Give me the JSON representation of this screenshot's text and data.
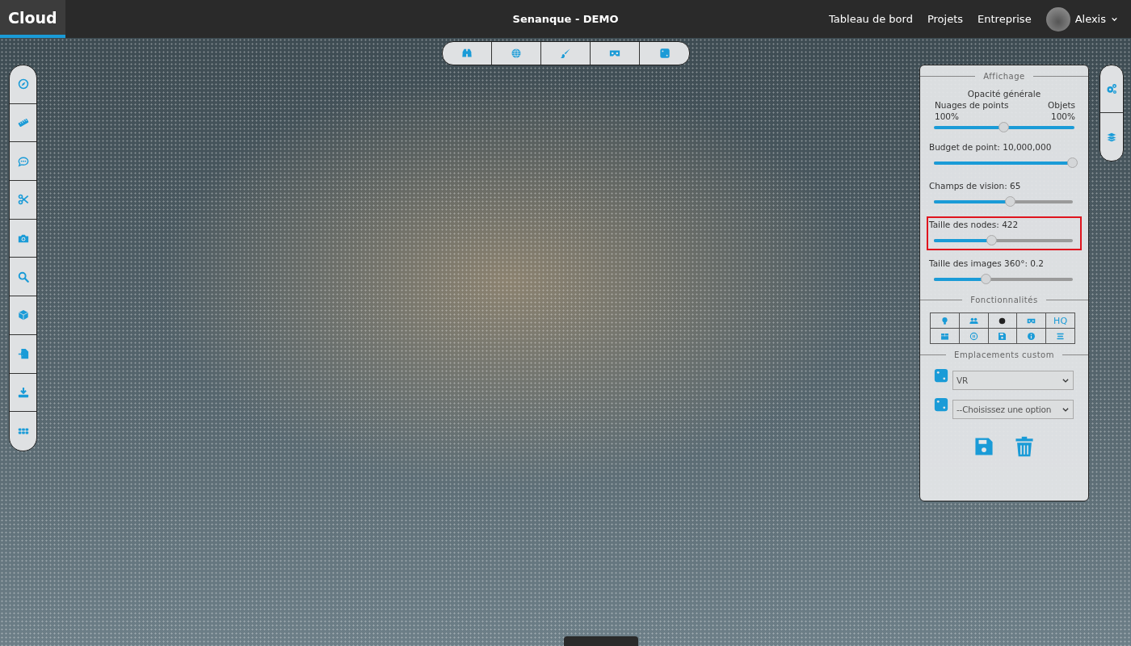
{
  "header": {
    "brand": "Cloud",
    "title": "Senanque - DEMO",
    "nav": [
      "Tableau de bord",
      "Projets",
      "Entreprise"
    ],
    "user": "Alexis"
  },
  "panel": {
    "display_title": "Affichage",
    "opacity": {
      "title": "Opacité générale",
      "left_label": "Nuages de points",
      "right_label": "Objets",
      "left_value": "100%",
      "right_value": "100%",
      "level": 0.5
    },
    "sliders": [
      {
        "label": "Budget de point: 10,000,000",
        "level": 1.0,
        "highlighted": false
      },
      {
        "label": "Champs de vision: 65",
        "level": 0.55,
        "highlighted": false
      },
      {
        "label": "Taille des nodes: 422",
        "level": 0.42,
        "highlighted": true
      },
      {
        "label": "Taille des images 360°: 0.2",
        "level": 0.38,
        "highlighted": false
      }
    ],
    "features_title": "Fonctionnalités",
    "hq_label": "HQ",
    "custom_title": "Emplacements custom",
    "selects": [
      {
        "value": "VR"
      },
      {
        "value": "--Choisissez une option"
      }
    ]
  }
}
